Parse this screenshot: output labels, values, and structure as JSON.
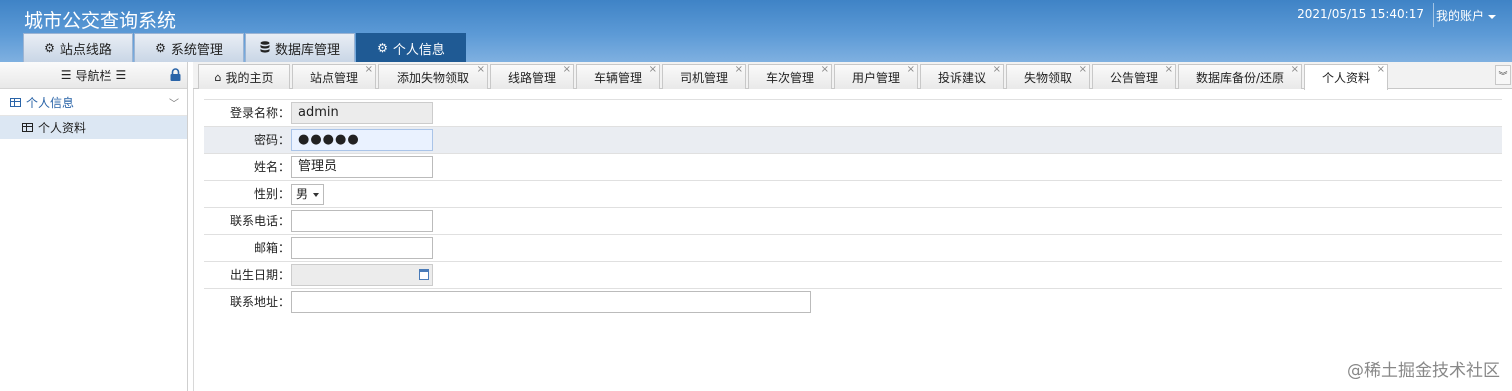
{
  "header": {
    "title": "城市公交查询系统",
    "datetime": "2021/05/15 15:40:17",
    "account_label": "我的账户"
  },
  "main_tabs": [
    {
      "label": "站点线路",
      "icon": "gear-icon"
    },
    {
      "label": "系统管理",
      "icon": "gear-icon"
    },
    {
      "label": "数据库管理",
      "icon": "database-icon"
    },
    {
      "label": "个人信息",
      "icon": "gear-icon",
      "active": true
    }
  ],
  "sidebar": {
    "title": "导航栏",
    "group_label": "个人信息",
    "item_label": "个人资料"
  },
  "tabs": [
    {
      "label": "我的主页",
      "closable": false
    },
    {
      "label": "站点管理",
      "closable": true
    },
    {
      "label": "添加失物领取",
      "closable": true
    },
    {
      "label": "线路管理",
      "closable": true
    },
    {
      "label": "车辆管理",
      "closable": true
    },
    {
      "label": "司机管理",
      "closable": true
    },
    {
      "label": "车次管理",
      "closable": true
    },
    {
      "label": "用户管理",
      "closable": true
    },
    {
      "label": "投诉建议",
      "closable": true
    },
    {
      "label": "失物领取",
      "closable": true
    },
    {
      "label": "公告管理",
      "closable": true
    },
    {
      "label": "数据库备份/还原",
      "closable": true
    },
    {
      "label": "个人资料",
      "closable": true,
      "active": true
    }
  ],
  "form": {
    "login_name_label": "登录名称：",
    "login_name_value": "admin",
    "password_label": "密码：",
    "password_value": "●●●●●",
    "name_label": "姓名：",
    "name_value": "管理员",
    "gender_label": "性别：",
    "gender_value": "男",
    "phone_label": "联系电话：",
    "phone_value": "",
    "email_label": "邮箱：",
    "email_value": "",
    "birth_label": "出生日期：",
    "birth_value": "",
    "address_label": "联系地址：",
    "address_value": ""
  },
  "watermark": "@稀土掘金技术社区",
  "colors": {
    "header_blue": "#3f83c6",
    "active_tab": "#1f5a94",
    "link_blue": "#2a64a8",
    "selected_item": "#dce7f3"
  }
}
